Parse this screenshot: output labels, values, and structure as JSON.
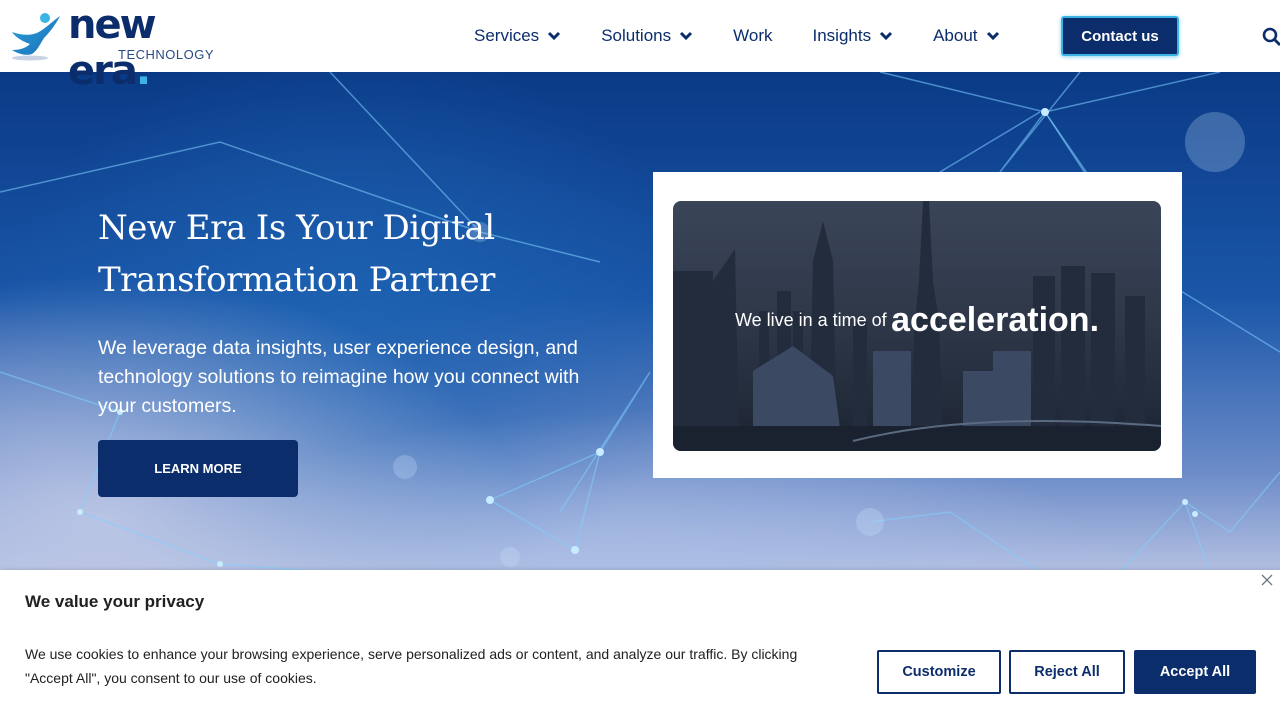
{
  "brand": {
    "name": "new era",
    "subtitle": "TECHNOLOGY",
    "primary_color": "#0c2d6b",
    "accent_color": "#3bb4e5"
  },
  "nav": {
    "items": [
      {
        "label": "Services",
        "has_dropdown": true
      },
      {
        "label": "Solutions",
        "has_dropdown": true
      },
      {
        "label": "Work",
        "has_dropdown": false
      },
      {
        "label": "Insights",
        "has_dropdown": true
      },
      {
        "label": "About",
        "has_dropdown": true
      }
    ],
    "contact_label": "Contact us",
    "search_icon": "search-icon"
  },
  "hero": {
    "title": "New Era Is Your Digital Transformation Partner",
    "text": "We leverage data insights, user experience design, and technology solutions to reimagine how you connect with your customers.",
    "cta_label": "LEARN MORE",
    "video": {
      "caption_small": "We live in a time of",
      "caption_big": "acceleration."
    }
  },
  "cookie": {
    "title": "We value your privacy",
    "text": "We use cookies to enhance your browsing experience, serve personalized ads or content, and analyze our traffic. By clicking \"Accept All\", you consent to our use of cookies.",
    "customize_label": "Customize",
    "reject_label": "Reject All",
    "accept_label": "Accept All"
  }
}
